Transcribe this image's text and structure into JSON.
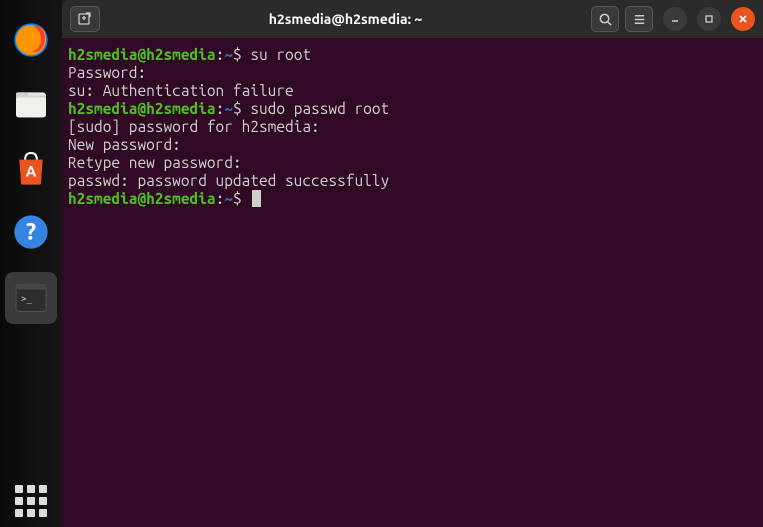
{
  "window": {
    "title": "h2smedia@h2smedia: ~"
  },
  "terminal": {
    "prompt1_user": "h2smedia@h2smedia",
    "prompt1_sep": ":",
    "prompt1_path": "~",
    "prompt1_sym": "$ ",
    "cmd1": "su root",
    "line2": "Password:",
    "line3": "su: Authentication failure",
    "prompt2_user": "h2smedia@h2smedia",
    "prompt2_sep": ":",
    "prompt2_path": "~",
    "prompt2_sym": "$ ",
    "cmd2": "sudo passwd root",
    "line5": "[sudo] password for h2smedia:",
    "line6": "New password:",
    "line7": "Retype new password:",
    "line8": "passwd: password updated successfully",
    "prompt3_user": "h2smedia@h2smedia",
    "prompt3_sep": ":",
    "prompt3_path": "~",
    "prompt3_sym": "$ "
  }
}
